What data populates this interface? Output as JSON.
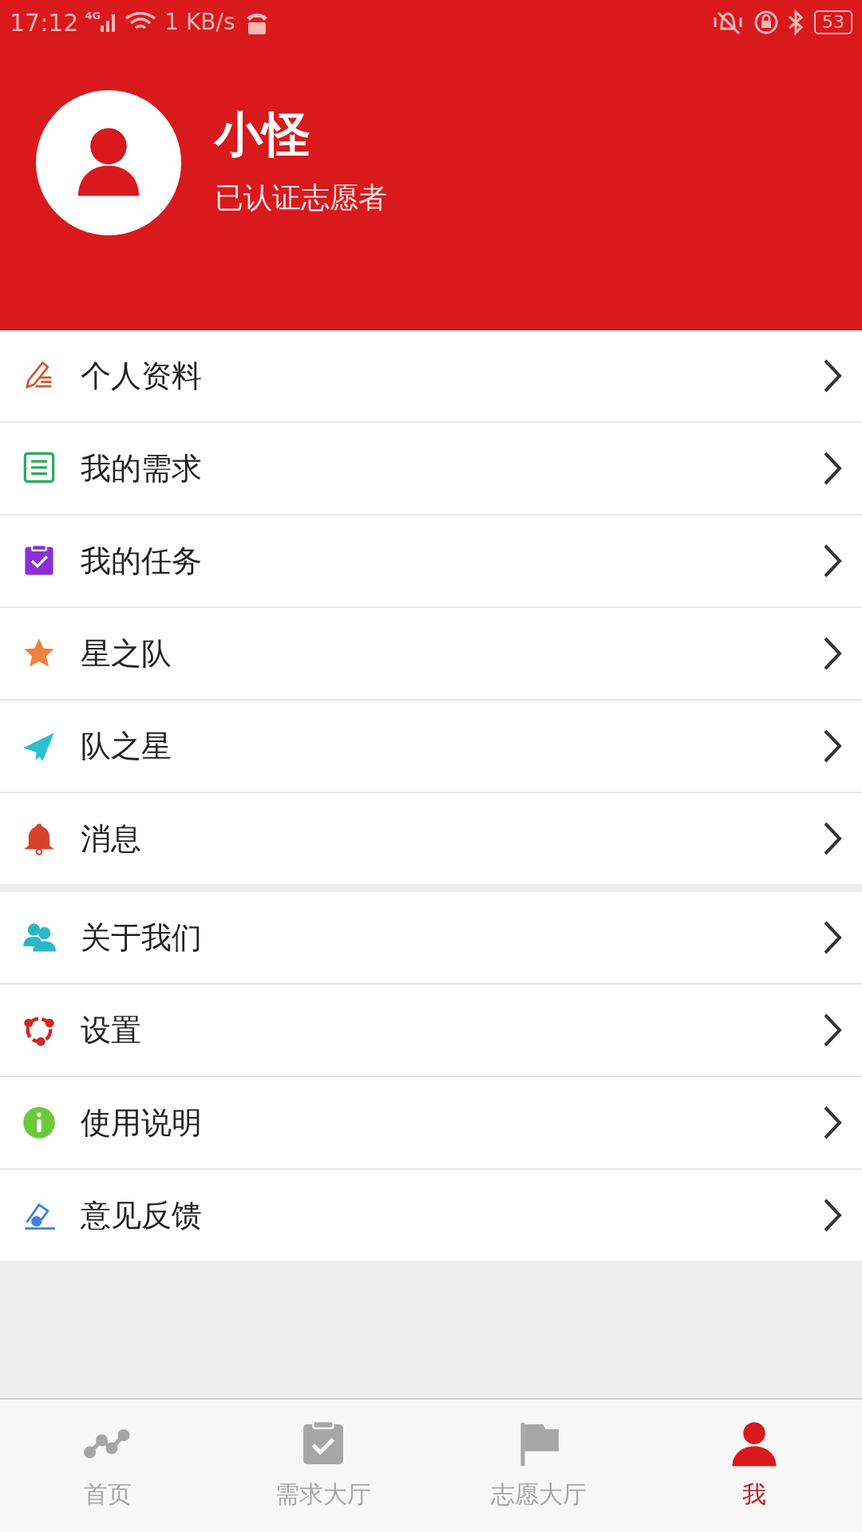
{
  "status_bar": {
    "time": "17:12",
    "network": "4G",
    "speed": "1 KB/s",
    "battery": "53"
  },
  "profile": {
    "name": "小怪",
    "subtitle": "已认证志愿者"
  },
  "menu_groups": [
    {
      "items": [
        {
          "label": "个人资料"
        },
        {
          "label": "我的需求"
        },
        {
          "label": "我的任务"
        },
        {
          "label": "星之队"
        },
        {
          "label": "队之星"
        },
        {
          "label": "消息"
        }
      ]
    },
    {
      "items": [
        {
          "label": "关于我们"
        },
        {
          "label": "设置"
        },
        {
          "label": "使用说明"
        },
        {
          "label": "意见反馈"
        }
      ]
    }
  ],
  "tab_bar": [
    {
      "label": "首页",
      "selected": false
    },
    {
      "label": "需求大厅",
      "selected": false
    },
    {
      "label": "志愿大厅",
      "selected": false
    },
    {
      "label": "我",
      "selected": true
    }
  ]
}
